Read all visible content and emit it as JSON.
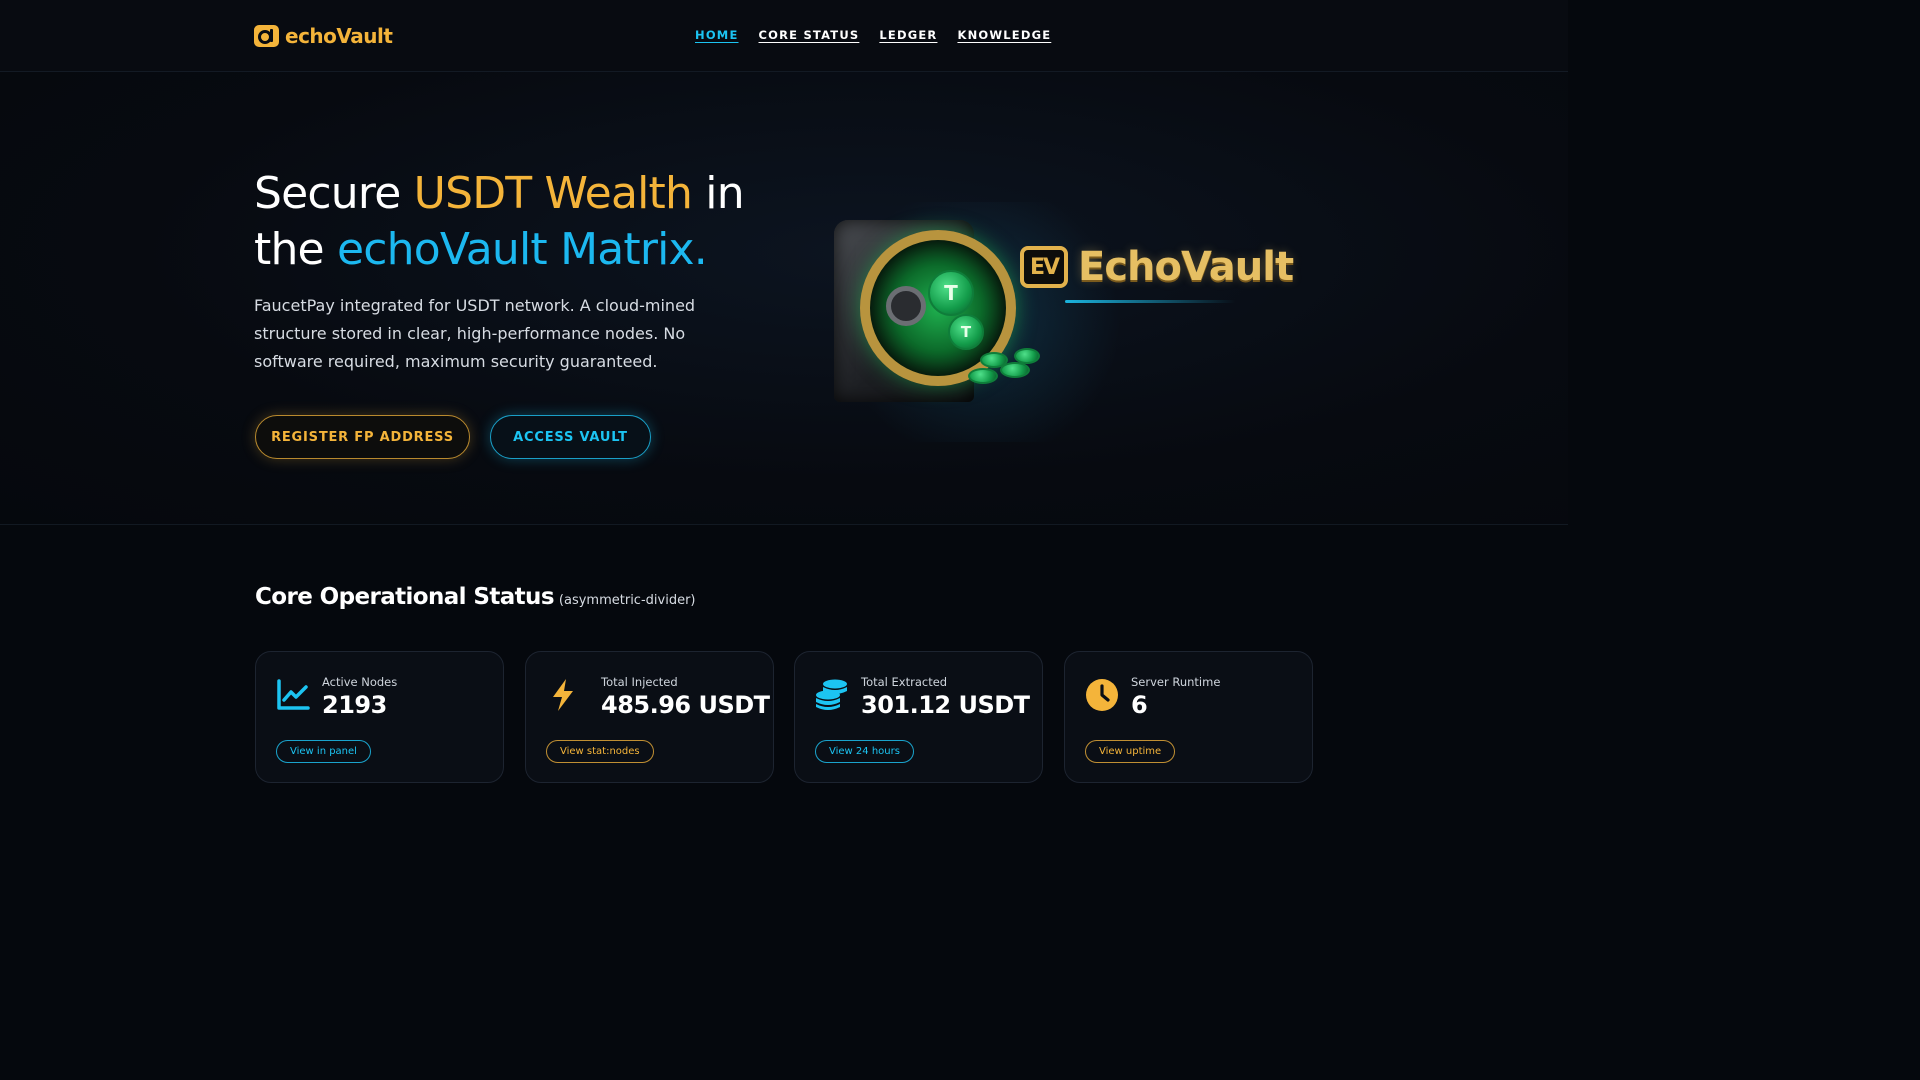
{
  "header": {
    "logo_text": "echoVault",
    "nav": [
      {
        "label": "HOME"
      },
      {
        "label": "CORE STATUS"
      },
      {
        "label": "LEDGER"
      },
      {
        "label": "KNOWLEDGE"
      }
    ]
  },
  "hero": {
    "title_part1": "Secure ",
    "title_gold": "USDT Wealth",
    "title_part2": " in the ",
    "title_blue": "echoVault Matrix.",
    "description": "FaucetPay integrated for USDT network. A cloud-mined structure stored in clear, high-performance nodes. No software required, maximum security guaranteed.",
    "primary_button": "REGISTER FP ADDRESS",
    "secondary_button": "ACCESS VAULT",
    "illustration": {
      "badge": "EV",
      "name": "EchoVault",
      "coin_symbol": "T"
    }
  },
  "status": {
    "title": "Core Operational Status",
    "subtitle": "(asymmetric-divider)",
    "cards": [
      {
        "icon": "chart-line-icon",
        "label": "Active Nodes",
        "value": "2193",
        "button": "View in panel",
        "accent": "#1cc4f2"
      },
      {
        "icon": "lightning-bolt-icon",
        "label": "Total Injected",
        "value": "485.96 USDT",
        "button": "View stat:nodes",
        "accent": "#f4b43a"
      },
      {
        "icon": "coin-stack-icon",
        "label": "Total Extracted",
        "value": "301.12 USDT",
        "button": "View 24 hours",
        "accent": "#1cc4f2"
      },
      {
        "icon": "clock-icon",
        "label": "Server Runtime",
        "value": "6",
        "button": "View uptime",
        "accent": "#f4b43a"
      }
    ]
  },
  "colors": {
    "gold": "#f4b43a",
    "blue": "#1cc4f2",
    "background": "#05080d"
  }
}
